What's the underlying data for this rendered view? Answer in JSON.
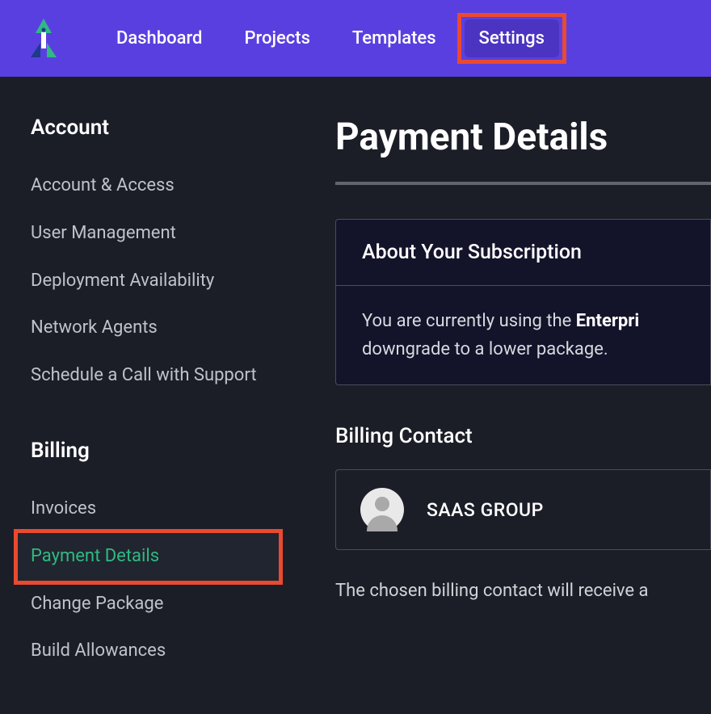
{
  "nav": {
    "items": [
      {
        "label": "Dashboard"
      },
      {
        "label": "Projects"
      },
      {
        "label": "Templates"
      },
      {
        "label": "Settings"
      }
    ]
  },
  "sidebar": {
    "account_title": "Account",
    "account_items": [
      {
        "label": "Account & Access"
      },
      {
        "label": "User Management"
      },
      {
        "label": "Deployment Availability"
      },
      {
        "label": "Network Agents"
      },
      {
        "label": "Schedule a Call with Support"
      }
    ],
    "billing_title": "Billing",
    "billing_items": [
      {
        "label": "Invoices"
      },
      {
        "label": "Payment Details"
      },
      {
        "label": "Change Package"
      },
      {
        "label": "Build Allowances"
      }
    ]
  },
  "main": {
    "page_title": "Payment Details",
    "subscription": {
      "header": "About Your Subscription",
      "body_prefix": "You are currently using the ",
      "plan": "Enterpri",
      "body_suffix": "downgrade to a lower package."
    },
    "billing_contact_title": "Billing Contact",
    "contact_name": "SAAS GROUP",
    "help_text": "The chosen billing contact will receive a"
  }
}
